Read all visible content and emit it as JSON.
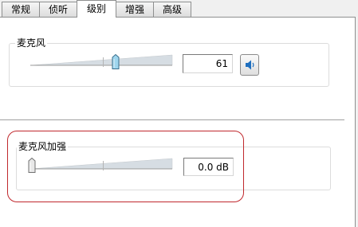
{
  "tabs": [
    {
      "label": "常规"
    },
    {
      "label": "侦听"
    },
    {
      "label": "级别"
    },
    {
      "label": "增强"
    },
    {
      "label": "高级"
    }
  ],
  "active_tab": "级别",
  "microphone": {
    "title": "麦克风",
    "value": "61",
    "slider_level": 0.61,
    "mute_icon": "speaker-icon"
  },
  "microphone_boost": {
    "title": "麦克风加强",
    "value": "0.0 dB",
    "slider_level": 0.0
  },
  "colors": {
    "highlight_border": "#c0282d",
    "thumb_fill": "#9fd6ee",
    "speaker_blue": "#1f6fbf"
  }
}
